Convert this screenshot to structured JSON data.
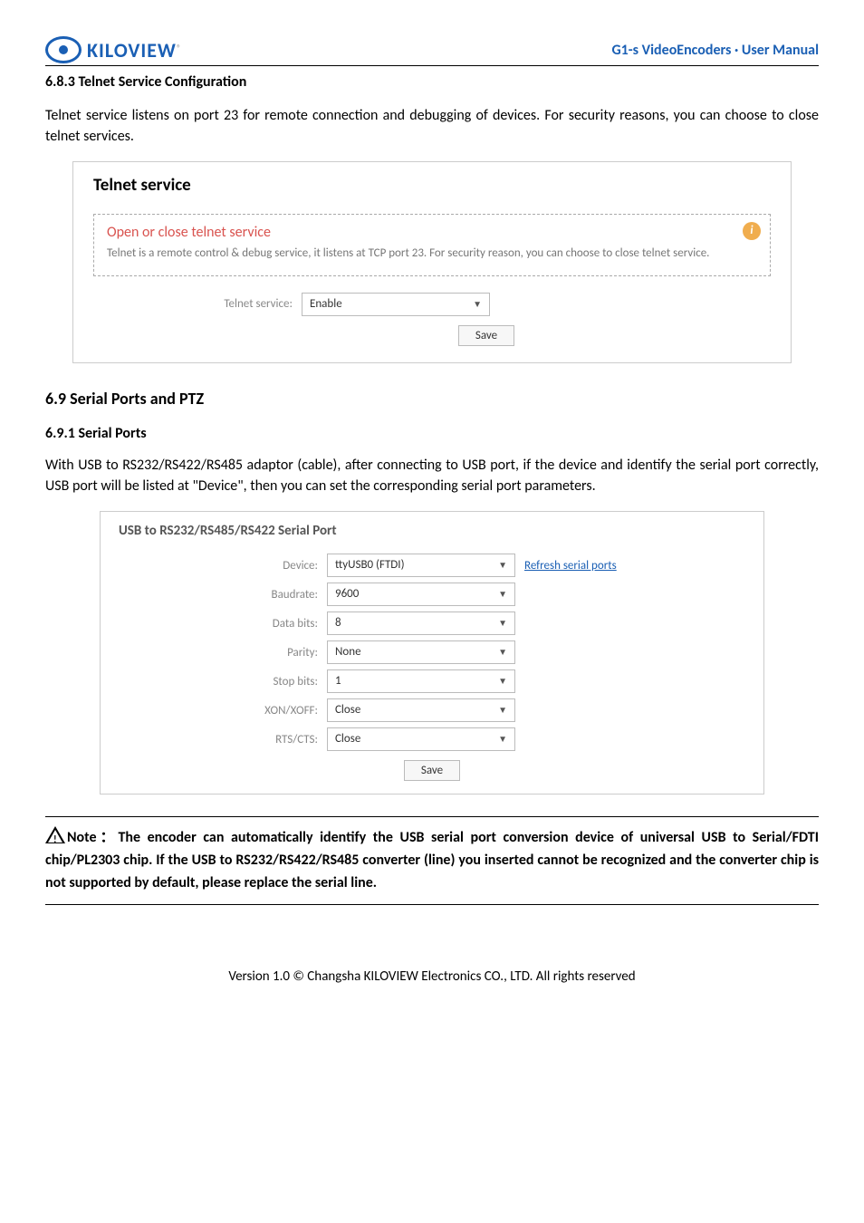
{
  "header": {
    "brand": "KILOVIEW",
    "brand_sup": "®",
    "doc_title": "G1-s VideoEncoders · User Manual"
  },
  "section_683": {
    "heading": "6.8.3   Telnet Service Configuration",
    "paragraph": "Telnet service listens on port 23 for remote connection and debugging of devices. For security reasons, you can choose to close telnet services."
  },
  "telnet_panel": {
    "title": "Telnet service",
    "box_title": "Open or close telnet service",
    "box_body": "Telnet is a remote control & debug service, it listens at TCP port 23. For security reason, you can choose to close telnet service.",
    "info_glyph": "i",
    "field_label": "Telnet service:",
    "field_value": "Enable",
    "save_label": "Save"
  },
  "section_69": {
    "heading": "6.9 Serial Ports and PTZ"
  },
  "section_691": {
    "heading": "6.9.1   Serial Ports",
    "paragraph": "With USB to RS232/RS422/RS485 adaptor (cable), after connecting to USB port, if the device and identify the serial port correctly, USB port will be listed at \"Device\", then you can set the corresponding serial port parameters."
  },
  "serial_panel": {
    "title": "USB to RS232/RS485/RS422 Serial Port",
    "labels": {
      "device": "Device:",
      "baudrate": "Baudrate:",
      "databits": "Data bits:",
      "parity": "Parity:",
      "stopbits": "Stop bits:",
      "xonxoff": "XON/XOFF:",
      "rtscts": "RTS/CTS:"
    },
    "values": {
      "device": "ttyUSB0 (FTDI)",
      "baudrate": "9600",
      "databits": "8",
      "parity": "None",
      "stopbits": "1",
      "xonxoff": "Close",
      "rtscts": "Close"
    },
    "refresh_link": "Refresh serial ports",
    "save_label": "Save"
  },
  "note": {
    "label": "Note：",
    "body": "The encoder can automatically identify the USB serial port conversion device of universal USB to Serial/FDTI chip/PL2303 chip. If the USB to RS232/RS422/RS485 converter (line) you inserted cannot be recognized and the converter chip is not supported by default, please replace the serial line."
  },
  "footer": "Version 1.0 © Changsha KILOVIEW Electronics CO., LTD. All rights reserved"
}
